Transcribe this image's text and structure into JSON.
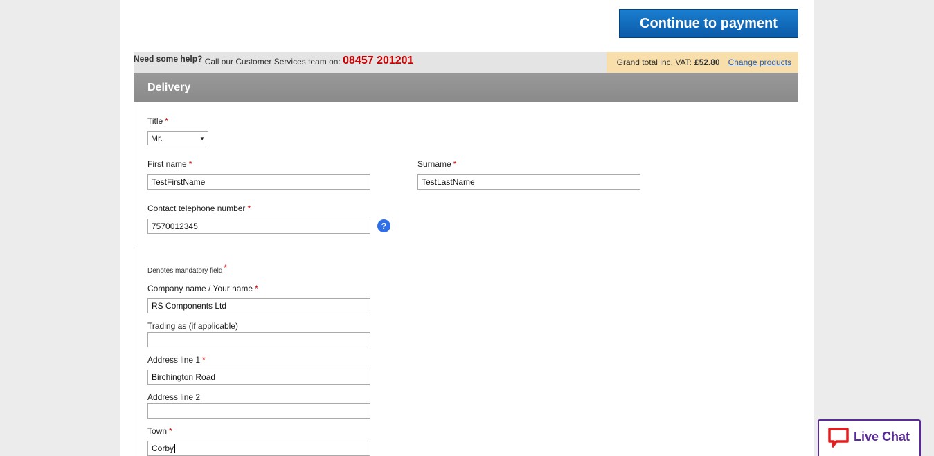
{
  "header": {
    "continue_label": "Continue to payment"
  },
  "help_bar": {
    "need_help": "Need some help?",
    "call_text": "Call our Customer Services team on:",
    "phone": "08457 201201",
    "grand_total_label": "Grand total inc. VAT:",
    "grand_total_value": "£52.80",
    "change_products": "Change products"
  },
  "section": {
    "title": "Delivery"
  },
  "form": {
    "title": {
      "label": "Title",
      "value": "Mr."
    },
    "first_name": {
      "label": "First name",
      "value": "TestFirstName"
    },
    "surname": {
      "label": "Surname",
      "value": "TestLastName"
    },
    "telephone": {
      "label": "Contact telephone number",
      "value": "7570012345"
    },
    "mandatory_note": "Denotes mandatory field",
    "company": {
      "label": "Company name / Your name",
      "value": "RS Components Ltd"
    },
    "trading_as": {
      "label": "Trading as (if applicable)",
      "value": ""
    },
    "address1": {
      "label": "Address line 1",
      "value": "Birchington Road"
    },
    "address2": {
      "label": "Address line 2",
      "value": ""
    },
    "town": {
      "label": "Town",
      "value": "Corby"
    },
    "required_marker": "*",
    "help_glyph": "?"
  },
  "livechat": {
    "label": "Live Chat",
    "icon": "chat-bubble-icon"
  },
  "colors": {
    "primary_button": "#0a5aa8",
    "phone_red": "#cc0000",
    "total_bg": "#f7deab",
    "header_grey": "#8a8a8a",
    "livechat_purple": "#5a2a9a"
  }
}
